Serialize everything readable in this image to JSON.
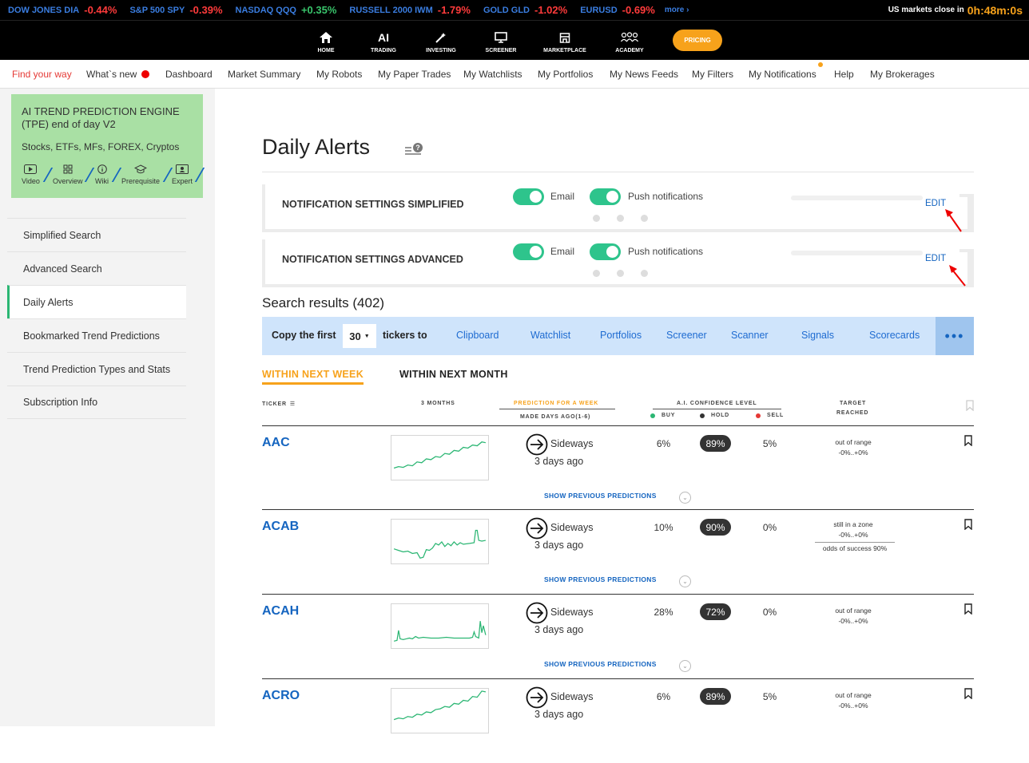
{
  "tickers": [
    {
      "name": "DOW JONES DIA",
      "change": "-0.44%"
    },
    {
      "name": "S&P 500 SPY",
      "change": "-0.39%"
    },
    {
      "name": "NASDAQ QQQ",
      "change": "+0.35%"
    },
    {
      "name": "RUSSELL 2000 IWM",
      "change": "-1.79%"
    },
    {
      "name": "GOLD GLD",
      "change": "-1.02%"
    },
    {
      "name": "EURUSD",
      "change": "-0.69%"
    }
  ],
  "ticker_more": "more ›",
  "market_close_label": "US markets close in",
  "market_close_time": "0h:48m:0s",
  "mainnav": {
    "home": "HOME",
    "ai_icon": "AI",
    "trading": "TRADING",
    "investing": "INVESTING",
    "screener": "SCREENER",
    "marketplace": "MARKETPLACE",
    "academy": "ACADEMY",
    "pricing": "PRICING"
  },
  "subnav": {
    "find": "Find your way",
    "whatsnew": "What`s new",
    "dashboard": "Dashboard",
    "market_summary": "Market Summary",
    "my_robots": "My Robots",
    "my_paper_trades": "My Paper Trades",
    "my_watchlists": "My Watchlists",
    "my_portfolios": "My Portfolios",
    "my_news_feeds": "My News Feeds",
    "my_filters": "My Filters",
    "my_notifications": "My Notifications",
    "help": "Help",
    "my_brokerages": "My Brokerages"
  },
  "promo": {
    "title": "AI TREND PREDICTION ENGINE (TPE) end of day V2",
    "subtitle": "Stocks, ETFs, MFs, FOREX, Cryptos",
    "links": {
      "video": "Video",
      "overview": "Overview",
      "wiki": "Wiki",
      "prerequisite": "Prerequisite",
      "expert": "Expert"
    }
  },
  "sidebar": {
    "simplified": "Simplified Search",
    "advanced": "Advanced Search",
    "daily": "Daily Alerts",
    "bookmarked": "Bookmarked Trend Predictions",
    "types": "Trend Prediction Types and Stats",
    "subscription": "Subscription Info"
  },
  "page_title": "Daily Alerts",
  "notif": {
    "simplified_label": "NOTIFICATION SETTINGS SIMPLIFIED",
    "advanced_label": "NOTIFICATION SETTINGS ADVANCED",
    "email": "Email",
    "push": "Push notifications",
    "edit": "EDIT",
    "email_on": true,
    "push_on": true
  },
  "results_title": "Search results (402)",
  "copybar": {
    "copy_first": "Copy the first",
    "count": "30",
    "tickers_to": "tickers to",
    "clipboard": "Clipboard",
    "watchlist": "Watchlist",
    "portfolios": "Portfolios",
    "screener": "Screener",
    "scanner": "Scanner",
    "signals": "Signals",
    "scorecards": "Scorecards",
    "more": "•••"
  },
  "tabs": {
    "week": "WITHIN NEXT WEEK",
    "month": "WITHIN NEXT MONTH"
  },
  "table_headers": {
    "ticker": "TICKER",
    "months": "3 MONTHS",
    "prediction": "PREDICTION FOR A WEEK",
    "made": "MADE DAYS AGO(1-6)",
    "confidence": "A.I. CONFIDENCE LEVEL",
    "buy": "BUY",
    "hold": "HOLD",
    "sell": "SELL",
    "target": "TARGET",
    "reached": "REACHED"
  },
  "colors": {
    "accent": "#f7a21b",
    "link": "#1565c0",
    "green": "#2ec48c",
    "buy": "#2bb673",
    "hold": "#333333",
    "sell": "#e53935"
  },
  "show_previous": "SHOW PREVIOUS PREDICTIONS",
  "rows": [
    {
      "ticker": "AAC",
      "direction": "Sideways",
      "ago": "3 days ago",
      "buy": "6%",
      "hold": "89%",
      "sell": "5%",
      "target1": "out of range",
      "target2": "-0%..+0%",
      "target3": ""
    },
    {
      "ticker": "ACAB",
      "direction": "Sideways",
      "ago": "3 days ago",
      "buy": "10%",
      "hold": "90%",
      "sell": "0%",
      "target1": "still in a zone",
      "target2": "-0%..+0%",
      "target3": "odds of success 90%"
    },
    {
      "ticker": "ACAH",
      "direction": "Sideways",
      "ago": "3 days ago",
      "buy": "28%",
      "hold": "72%",
      "sell": "0%",
      "target1": "out of range",
      "target2": "-0%..+0%",
      "target3": ""
    },
    {
      "ticker": "ACRO",
      "direction": "Sideways",
      "ago": "3 days ago",
      "buy": "6%",
      "hold": "89%",
      "sell": "5%",
      "target1": "out of range",
      "target2": "-0%..+0%",
      "target3": ""
    }
  ]
}
